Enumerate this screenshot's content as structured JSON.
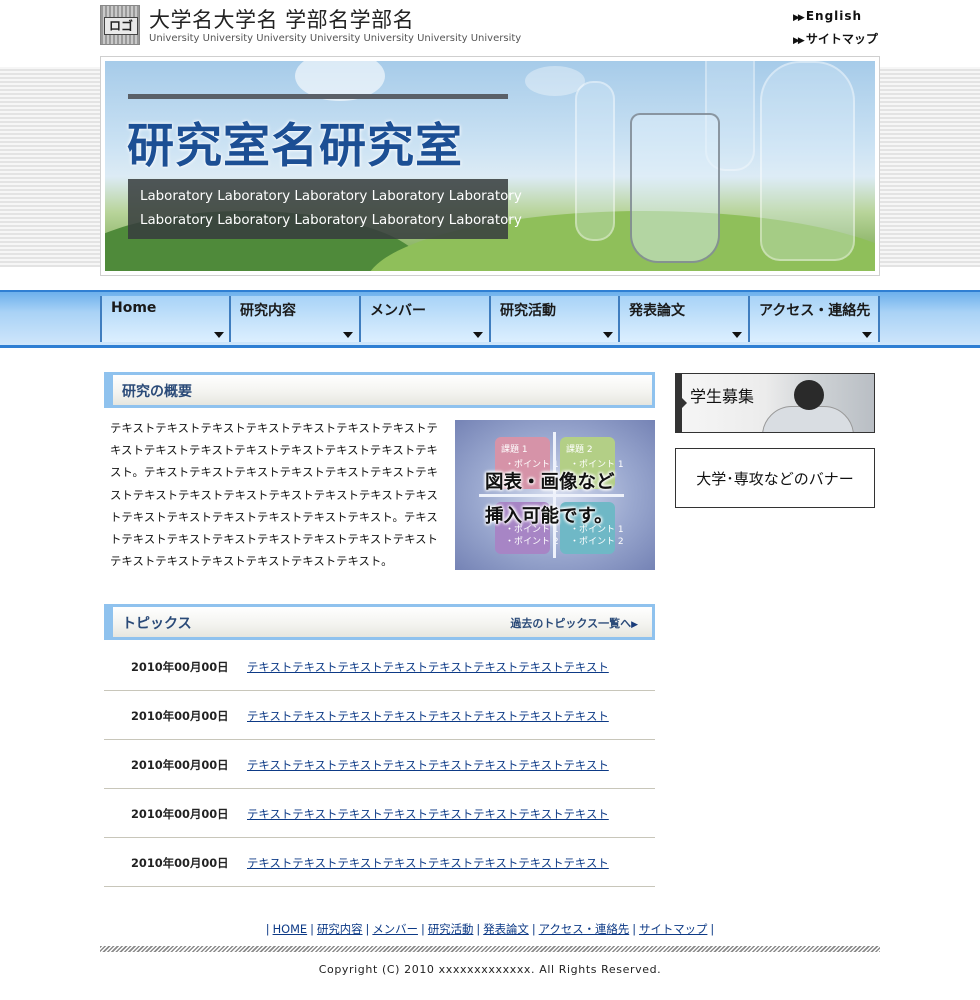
{
  "header": {
    "logo_text": "ロゴ",
    "title": "大学名大学名 学部名学部名",
    "subtitle": "University University University University University University University",
    "links": [
      {
        "label": "English"
      },
      {
        "label": "サイトマップ"
      }
    ]
  },
  "hero": {
    "title": "研究室名研究室",
    "caption_lines": [
      "Laboratory Laboratory Laboratory Laboratory Laboratory",
      "Laboratory Laboratory Laboratory Laboratory Laboratory"
    ]
  },
  "nav": {
    "items": [
      {
        "label": "Home"
      },
      {
        "label": "研究内容"
      },
      {
        "label": "メンバー"
      },
      {
        "label": "研究活動"
      },
      {
        "label": "発表論文"
      },
      {
        "label": "アクセス・連絡先"
      }
    ]
  },
  "overview": {
    "heading": "研究の概要",
    "body": "テキストテキストテキストテキストテキストテキストテキストテキストテキストテキストテキストテキストテキストテキストテキスト。テキストテキストテキストテキストテキストテキストテキストテキストテキストテキストテキストテキストテキストテキストテキストテキストテキストテキストテキストテキスト。テキストテキストテキストテキストテキストテキストテキストテキストテキストテキストテキストテキストテキストテキスト。",
    "figure": {
      "line1": "図表・画像など",
      "line2": "挿入可能です。",
      "quad_1_title": "課題 1",
      "quad_2_title": "課題 2",
      "quad_point": "・ポイント 1",
      "quad_point2": "・ポイント 2"
    }
  },
  "topics": {
    "heading": "トピックス",
    "archive_link": "過去のトピックス一覧へ",
    "items": [
      {
        "date": "2010年00月00日",
        "text": "テキストテキストテキストテキストテキストテキストテキストテキスト"
      },
      {
        "date": "2010年00月00日",
        "text": "テキストテキストテキストテキストテキストテキストテキストテキスト"
      },
      {
        "date": "2010年00月00日",
        "text": "テキストテキストテキストテキストテキストテキストテキストテキスト"
      },
      {
        "date": "2010年00月00日",
        "text": "テキストテキストテキストテキストテキストテキストテキストテキスト"
      },
      {
        "date": "2010年00月00日",
        "text": "テキストテキストテキストテキストテキストテキストテキストテキスト"
      }
    ]
  },
  "side": {
    "recruit_label": "学生募集",
    "banner_label": "大学･専攻などのバナー"
  },
  "footer": {
    "links": [
      "HOME",
      "研究内容",
      "メンバー",
      "研究活動",
      "発表論文",
      "アクセス・連絡先",
      "サイトマップ"
    ],
    "copyright": "Copyright (C) 2010 xxxxxxxxxxxxx. All Rights Reserved."
  },
  "colors": {
    "nav_blue": "#2f7fd3",
    "accent_light_blue": "#8fc2ee",
    "heading_text": "#2a4a78",
    "hero_title": "#1c4f94",
    "link": "#0d3a86"
  }
}
